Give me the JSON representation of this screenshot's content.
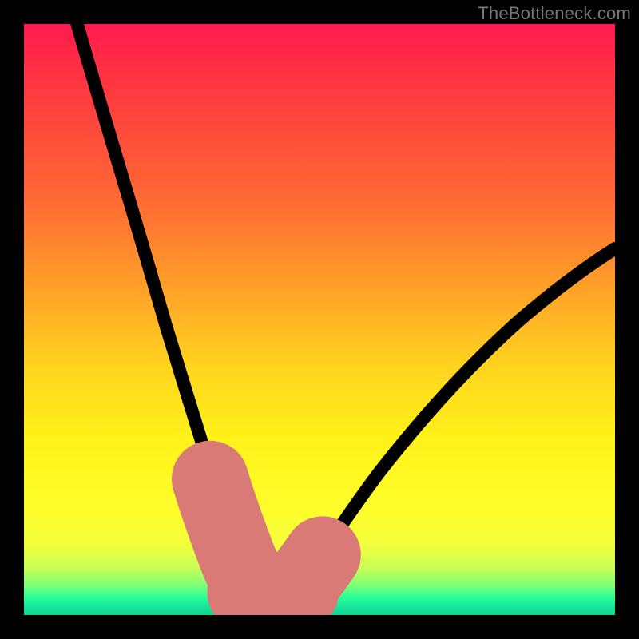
{
  "watermark": "TheBottleneck.com",
  "colors": {
    "background": "#000000",
    "gradient_top": "#ff1a4d",
    "gradient_mid1": "#ff6a34",
    "gradient_mid2": "#ffd41e",
    "gradient_mid3": "#fffe2a",
    "gradient_bottom": "#0fd58f",
    "curve": "#000000",
    "highlight": "#d97a77"
  },
  "chart_data": {
    "type": "line",
    "title": "",
    "xlabel": "",
    "ylabel": "",
    "xlim": [
      0,
      100
    ],
    "ylim": [
      0,
      100
    ],
    "grid": false,
    "legend": false,
    "annotations": [
      {
        "text": "TheBottleneck.com",
        "position": "top-right"
      }
    ],
    "description": "Single V-shaped bottleneck curve over a vertical red→yellow→green heat gradient. Minimum near x≈40 at y≈3. Left branch rises steeply from minimum toward (9,100); right branch rises more gently toward (100,62). Salmon dashed overlay marks the segments adjacent to the trough.",
    "series": [
      {
        "name": "bottleneck-curve",
        "x": [
          9,
          12,
          16,
          20,
          24,
          28,
          31,
          33,
          35,
          37,
          39,
          41,
          43,
          45,
          48,
          52,
          58,
          65,
          72,
          80,
          88,
          95,
          100
        ],
        "y": [
          100,
          88,
          74,
          61,
          49,
          37,
          28,
          21,
          14,
          8,
          4,
          3,
          3,
          4,
          7,
          12,
          20,
          29,
          37,
          45,
          52,
          58,
          62
        ]
      }
    ],
    "highlight_segments": [
      {
        "name": "left-approach",
        "x": [
          31,
          37
        ],
        "y": [
          24,
          8
        ],
        "style": "dashed"
      },
      {
        "name": "trough-flat",
        "x": [
          37,
          46
        ],
        "y": [
          3.5,
          3.5
        ],
        "style": "solid"
      },
      {
        "name": "right-approach",
        "x": [
          46,
          50
        ],
        "y": [
          5,
          11
        ],
        "style": "dashed"
      }
    ]
  }
}
